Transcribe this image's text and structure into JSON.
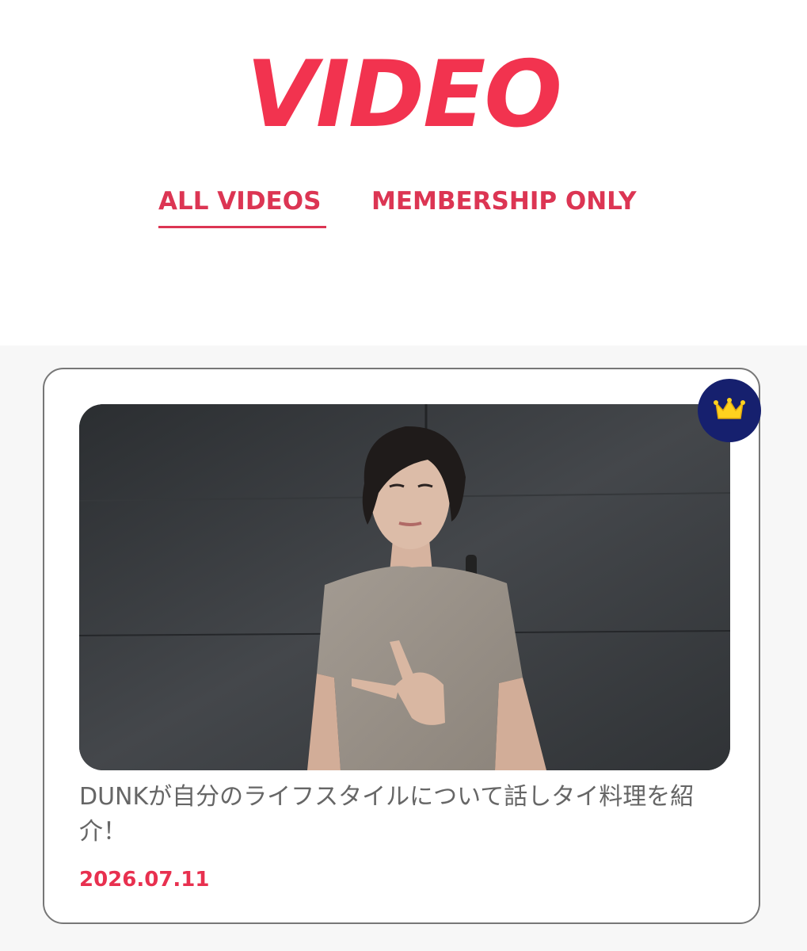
{
  "page": {
    "title": "VIDEO"
  },
  "tabs": [
    {
      "label": "ALL VIDEOS",
      "active": true
    },
    {
      "label": "MEMBERSHIP ONLY",
      "active": false
    }
  ],
  "videos": [
    {
      "title": "DUNKが自分のライフスタイルについて話しタイ料理を紹介！",
      "date": "2026.07.11",
      "membership_only": true,
      "badge_icon": "crown-icon"
    }
  ],
  "colors": {
    "accent": "#f2334f",
    "tab_text": "#dc3553",
    "badge_bg": "#16206e",
    "crown": "#ffd21f"
  }
}
